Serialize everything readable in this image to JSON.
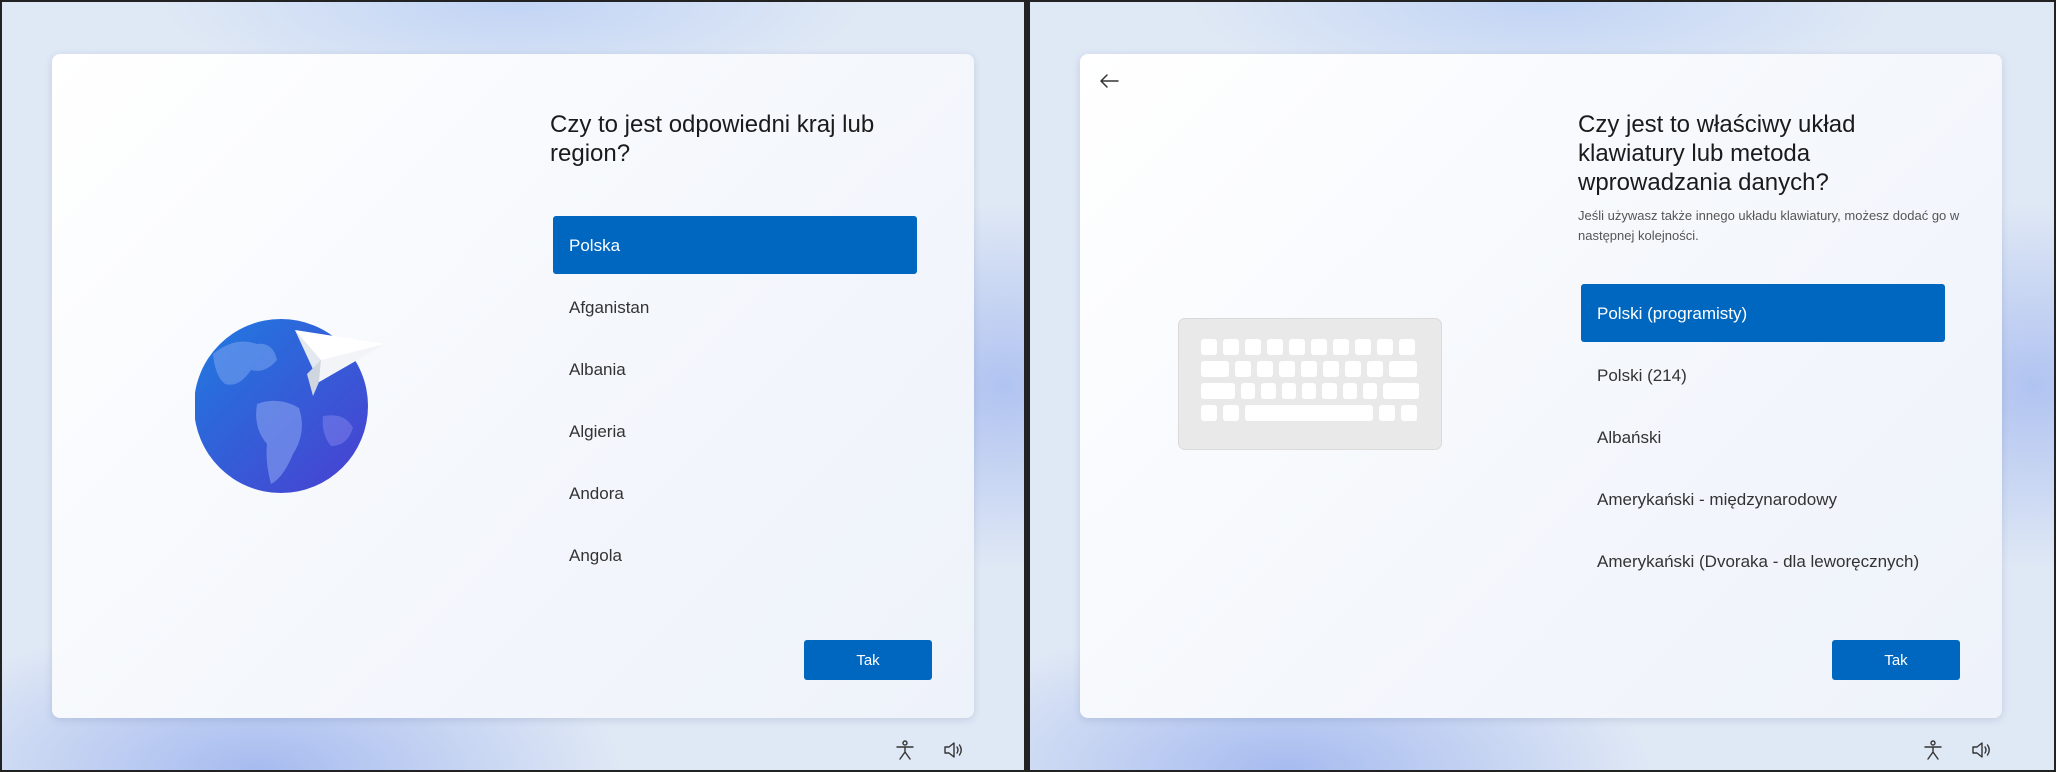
{
  "left_screen": {
    "title": "Czy to jest odpowiedni kraj lub region?",
    "regions": [
      "Polska",
      "Afganistan",
      "Albania",
      "Algieria",
      "Andora",
      "Angola"
    ],
    "selected_index": 0,
    "confirm_label": "Tak"
  },
  "right_screen": {
    "title": "Czy jest to właściwy układ klawiatury lub metoda wprowadzania danych?",
    "subtitle": "Jeśli używasz także innego układu klawiatury, możesz dodać go w następnej kolejności.",
    "layouts": [
      "Polski (programisty)",
      "Polski (214)",
      "Albański",
      "Amerykański - międzynarodowy",
      "Amerykański (Dvoraka - dla leworęcznych)"
    ],
    "selected_index": 0,
    "confirm_label": "Tak"
  },
  "icons": {
    "back": "back-arrow-icon",
    "accessibility": "accessibility-icon",
    "volume": "volume-icon",
    "globe": "globe-with-paper-plane-illustration",
    "keyboard": "keyboard-illustration"
  },
  "colors": {
    "accent": "#0067c0",
    "background": "#dfe8f5",
    "card": "#ffffff"
  }
}
